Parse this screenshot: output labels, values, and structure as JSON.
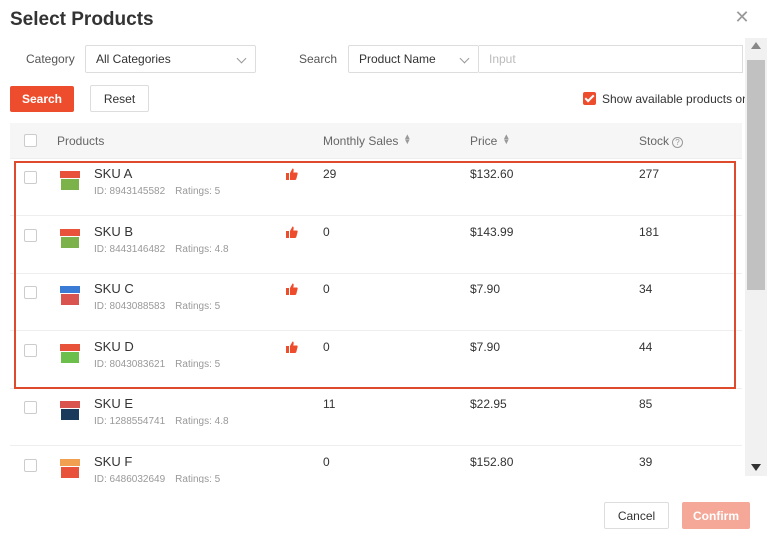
{
  "modal": {
    "title": "Select Products",
    "close_icon": "close-icon"
  },
  "filters": {
    "category_label": "Category",
    "category_value": "All Categories",
    "search_label": "Search",
    "search_field": "Product Name",
    "search_placeholder": "Input"
  },
  "actions": {
    "search_label": "Search",
    "reset_label": "Reset",
    "show_available_label": "Show available products on",
    "show_available_checked": true
  },
  "table": {
    "columns": {
      "products": "Products",
      "monthly_sales": "Monthly Sales",
      "price": "Price",
      "stock": "Stock"
    },
    "rows": [
      {
        "name": "SKU A",
        "id": "ID: 8943145582",
        "ratings": "Ratings: 5",
        "sales": "29",
        "price": "$132.60",
        "stock": "277",
        "thumbup": true
      },
      {
        "name": "SKU B",
        "id": "ID: 8443146482",
        "ratings": "Ratings: 4.8",
        "sales": "0",
        "price": "$143.99",
        "stock": "181",
        "thumbup": true
      },
      {
        "name": "SKU C",
        "id": "ID: 8043088583",
        "ratings": "Ratings: 5",
        "sales": "0",
        "price": "$7.90",
        "stock": "34",
        "thumbup": true
      },
      {
        "name": "SKU D",
        "id": "ID: 8043083621",
        "ratings": "Ratings: 5",
        "sales": "0",
        "price": "$7.90",
        "stock": "44",
        "thumbup": true
      },
      {
        "name": "SKU E",
        "id": "ID: 1288554741",
        "ratings": "Ratings: 4.8",
        "sales": "11",
        "price": "$22.95",
        "stock": "85",
        "thumbup": false
      },
      {
        "name": "SKU F",
        "id": "ID: 6486032649",
        "ratings": "Ratings: 5",
        "sales": "0",
        "price": "$152.80",
        "stock": "39",
        "thumbup": false
      }
    ]
  },
  "footer": {
    "cancel_label": "Cancel",
    "confirm_label": "Confirm"
  },
  "colors": {
    "accent": "#ee4d2d",
    "highlight": "#e04a2c",
    "confirm_disabled": "#f5a898"
  }
}
